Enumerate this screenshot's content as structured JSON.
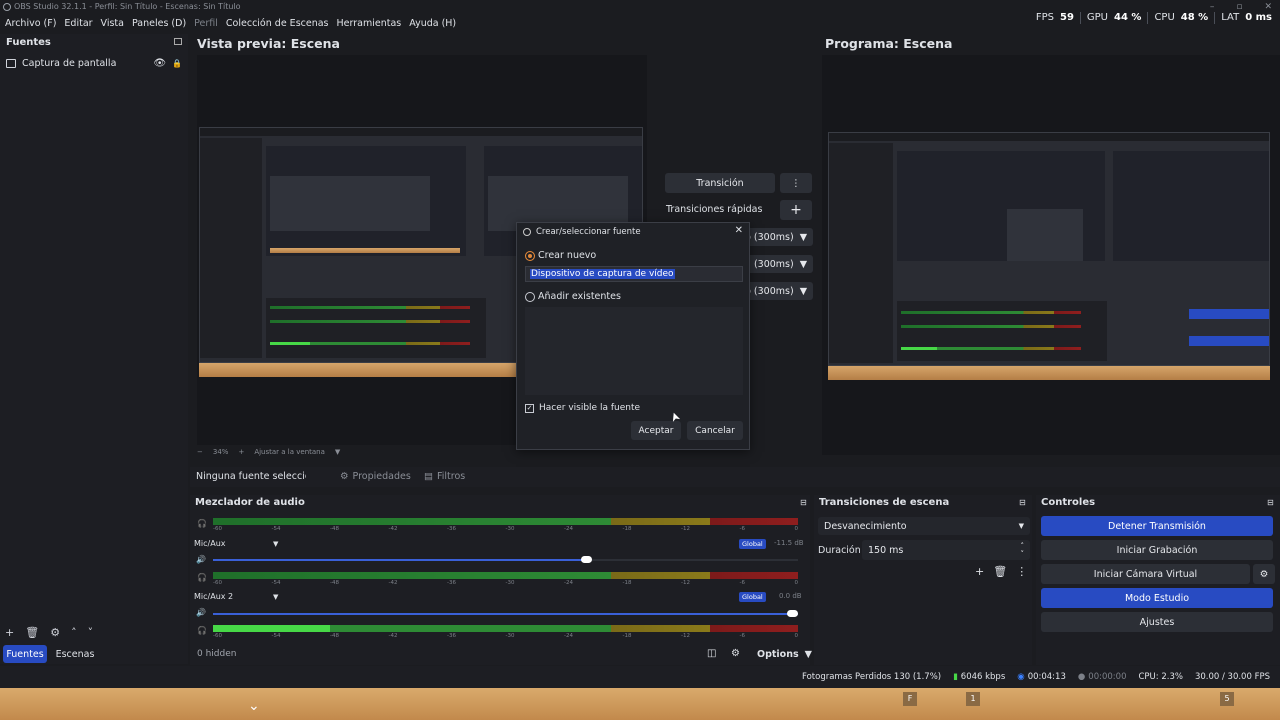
{
  "window": {
    "title": "OBS Studio 32.1.1 - Perfil: Sin Título - Escenas: Sin Título"
  },
  "menu": [
    "Archivo (F)",
    "Editar",
    "Vista",
    "Paneles (D)",
    "Perfil",
    "Colección de Escenas",
    "Herramientas",
    "Ayuda (H)"
  ],
  "stats": {
    "fps_label": "FPS",
    "fps": "59",
    "gpu_label": "GPU",
    "gpu": "44 %",
    "cpu_label": "CPU",
    "cpu": "48 %",
    "lat_label": "LAT",
    "lat": "0 ms"
  },
  "sources_dock": {
    "title": "Fuentes",
    "items": [
      {
        "label": "Captura de pantalla"
      }
    ],
    "hidden_count": "0 hidden",
    "tab_sources": "Fuentes",
    "tab_scenes": "Escenas"
  },
  "preview": {
    "title": "Vista previa: Escena",
    "zoom": "34%",
    "fit_label": "Ajustar a la ventana"
  },
  "program": {
    "title": "Programa: Escena"
  },
  "transition_panel": {
    "transition_label": "Transición",
    "quick_label": "Transiciones rápidas",
    "durations": [
      "o (300ms)",
      "(300ms)",
      "o (300ms)"
    ]
  },
  "source_toolbar": {
    "no_source": "Ninguna fuente seleccionac",
    "properties": "Propiedades",
    "filters": "Filtros"
  },
  "mixer": {
    "title": "Mezclador de audio",
    "ticks": [
      "-60",
      "-54",
      "-48",
      "-42",
      "-36",
      "-30",
      "-24",
      "-18",
      "-12",
      "-6",
      "0"
    ],
    "channels": [
      {
        "name": "Mic/Aux",
        "badge": "Global",
        "db": "-11.5 dB",
        "level": 0.64
      },
      {
        "name": "Mic/Aux 2",
        "badge": "Global",
        "db": "0.0 dB",
        "level": 1.0
      }
    ]
  },
  "scene_transitions": {
    "title": "Transiciones de escena",
    "selected": "Desvanecimiento",
    "duration_label": "Duración",
    "duration_value": "150 ms"
  },
  "controls": {
    "title": "Controles",
    "stop_stream": "Detener Transmisión",
    "start_recording": "Iniciar Grabación",
    "start_virtualcam": "Iniciar Cámara Virtual",
    "studio_mode": "Modo Estudio",
    "settings": "Ajustes"
  },
  "dialog": {
    "title": "Crear/seleccionar fuente",
    "create_new": "Crear nuevo",
    "name_value": "Dispositivo de captura de vídeo",
    "add_existing": "Añadir existentes",
    "make_visible": "Hacer visible la fuente",
    "ok": "Aceptar",
    "cancel": "Cancelar"
  },
  "options_label": "Options",
  "statusbar": {
    "dropped": "Fotogramas Perdidos 130 (1.7%)",
    "bitrate": "6046 kbps",
    "stream_time": "00:04:13",
    "rec_time": "00:00:00",
    "cpu": "CPU: 2.3%",
    "fps": "30.00 / 30.00 FPS"
  },
  "game_hud": {
    "f_key": "F",
    "key_1": "1",
    "key_5": "5"
  }
}
